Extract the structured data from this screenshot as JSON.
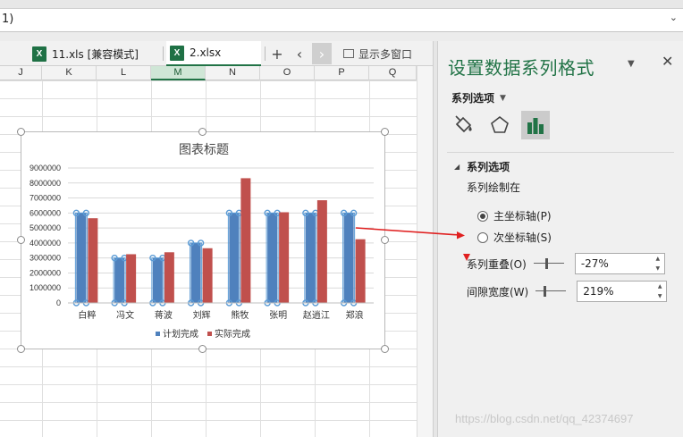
{
  "formula_bar": {
    "text": "1)",
    "dropdown_glyph": "⌄"
  },
  "tabs": [
    {
      "icon": "X",
      "label": "11.xls  [兼容模式]",
      "active": false
    },
    {
      "icon": "X",
      "label": "2.xlsx",
      "active": true
    }
  ],
  "tab_controls": {
    "add": "+",
    "prev": "‹",
    "next": "›",
    "multi_window": "显示多窗口"
  },
  "columns": [
    "J",
    "K",
    "L",
    "M",
    "N",
    "O",
    "P",
    "Q"
  ],
  "selected_column": "M",
  "chart_data": {
    "type": "bar",
    "title": "图表标题",
    "categories": [
      "白粹",
      "冯文",
      "蒋波",
      "刘辉",
      "熊牧",
      "张明",
      "赵逍江",
      "郑浪"
    ],
    "series": [
      {
        "name": "计划完成",
        "color": "#4f81bd",
        "values": [
          6000000,
          3000000,
          3000000,
          4000000,
          6000000,
          6000000,
          6000000,
          6000000
        ]
      },
      {
        "name": "实际完成",
        "color": "#c0504d",
        "values": [
          5650000,
          3250000,
          3380000,
          3650000,
          8320000,
          6050000,
          6850000,
          4250000
        ]
      }
    ],
    "ylim": [
      0,
      9000000
    ],
    "yticks": [
      "0",
      "1000000",
      "2000000",
      "3000000",
      "4000000",
      "5000000",
      "6000000",
      "7000000",
      "8000000",
      "9000000"
    ],
    "legend": "bottom",
    "grid": true
  },
  "panel": {
    "title": "设置数据系列格式",
    "dropdown_glyph": "▼",
    "close_glyph": "✕",
    "series_options_label": "系列选项",
    "section_title": "系列选项",
    "plot_on_label": "系列绘制在",
    "primary_axis": "主坐标轴(P)",
    "secondary_axis": "次坐标轴(S)",
    "overlap_label": "系列重叠(O)",
    "overlap_value": "-27%",
    "gap_label": "间隙宽度(W)",
    "gap_value": "219%",
    "selected_axis": "primary"
  },
  "watermark": "https://blog.csdn.net/qq_42374697",
  "colors": {
    "accent": "#217346",
    "series1": "#4f81bd",
    "series2": "#c0504d",
    "annotation": "#e02020"
  }
}
